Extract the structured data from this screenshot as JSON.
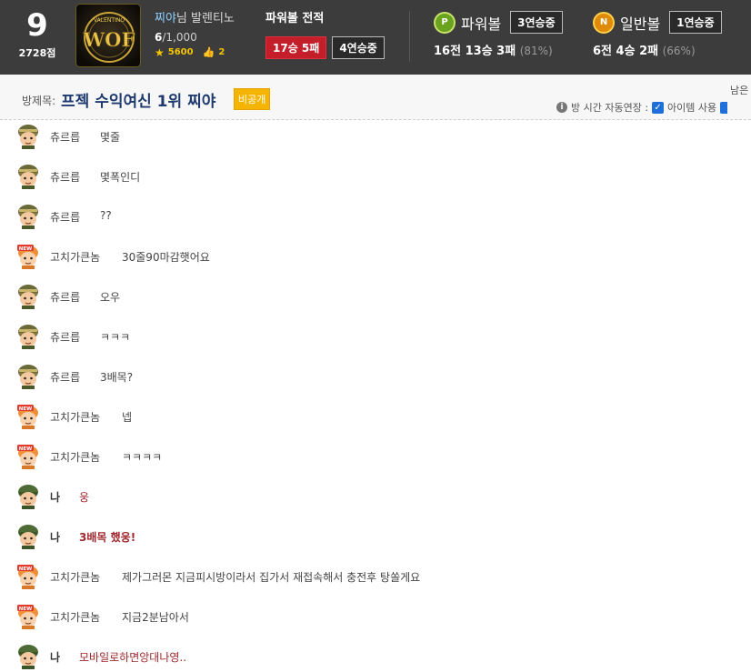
{
  "header": {
    "level": "9",
    "points": "2728점",
    "logo_text": "WOF",
    "logo_small": "VALENTINO",
    "nickname": "찌야",
    "nick_suffix": "님",
    "team": "발렌티노",
    "count_current": "6",
    "count_max": "/1,000",
    "stars": "5600",
    "likes": "2",
    "record_title": "파워볼 전적",
    "record_wl": "17승 5패",
    "record_streak": "4연승중",
    "powerball": {
      "icon": "P",
      "name": "파워볼",
      "streak": "3연승중",
      "record": "16전 13승 3패",
      "pct": "(81%)"
    },
    "normalball": {
      "icon": "N",
      "name": "일반볼",
      "streak": "1연승중",
      "record": "6전 4승 2패",
      "pct": "(66%)"
    }
  },
  "room": {
    "label": "방제목:",
    "title": "프젝 수익여신 1위 찌야",
    "private_badge": "비공개",
    "remain_label": "남은",
    "option_text": "방 시간 자동연장 :",
    "item_text": "아이템 사용"
  },
  "colors": {
    "header_bg": "#3c3c3c",
    "nick": "#8fd1ff",
    "room_title": "#1e3a6e",
    "my_message": "#a0282d",
    "badge_red": "#c41e2a",
    "badge_yellow": "#f5b400"
  },
  "messages": [
    {
      "avatar": "soldier",
      "name": "츄르릅",
      "text": "몇줄",
      "me": false
    },
    {
      "avatar": "soldier",
      "name": "츄르릅",
      "text": "몇폭인디",
      "me": false
    },
    {
      "avatar": "soldier",
      "name": "츄르릅",
      "text": "??",
      "me": false
    },
    {
      "avatar": "new",
      "name": "고치가큰놈",
      "text": "30줄90마감햇어요",
      "me": false
    },
    {
      "avatar": "soldier",
      "name": "츄르릅",
      "text": "오우",
      "me": false
    },
    {
      "avatar": "soldier",
      "name": "츄르릅",
      "text": "ㅋㅋㅋ",
      "me": false
    },
    {
      "avatar": "soldier",
      "name": "츄르릅",
      "text": "3배목?",
      "me": false
    },
    {
      "avatar": "new",
      "name": "고치가큰놈",
      "text": "넵",
      "me": false
    },
    {
      "avatar": "new",
      "name": "고치가큰놈",
      "text": "ㅋㅋㅋㅋ",
      "me": false
    },
    {
      "avatar": "army",
      "name": "나",
      "text": "웅",
      "me": true,
      "bold": false
    },
    {
      "avatar": "army",
      "name": "나",
      "text": "3배목 했웅!",
      "me": true,
      "bold": true
    },
    {
      "avatar": "new",
      "name": "고치가큰놈",
      "text": "제가그러몬 지금피시방이라서 집가서 재접속해서 충전후 탕쏠게요",
      "me": false
    },
    {
      "avatar": "new",
      "name": "고치가큰놈",
      "text": "지금2분남아서",
      "me": false
    },
    {
      "avatar": "army",
      "name": "나",
      "text": "모바일로하면앙대나영..",
      "me": true,
      "bold": false
    }
  ]
}
